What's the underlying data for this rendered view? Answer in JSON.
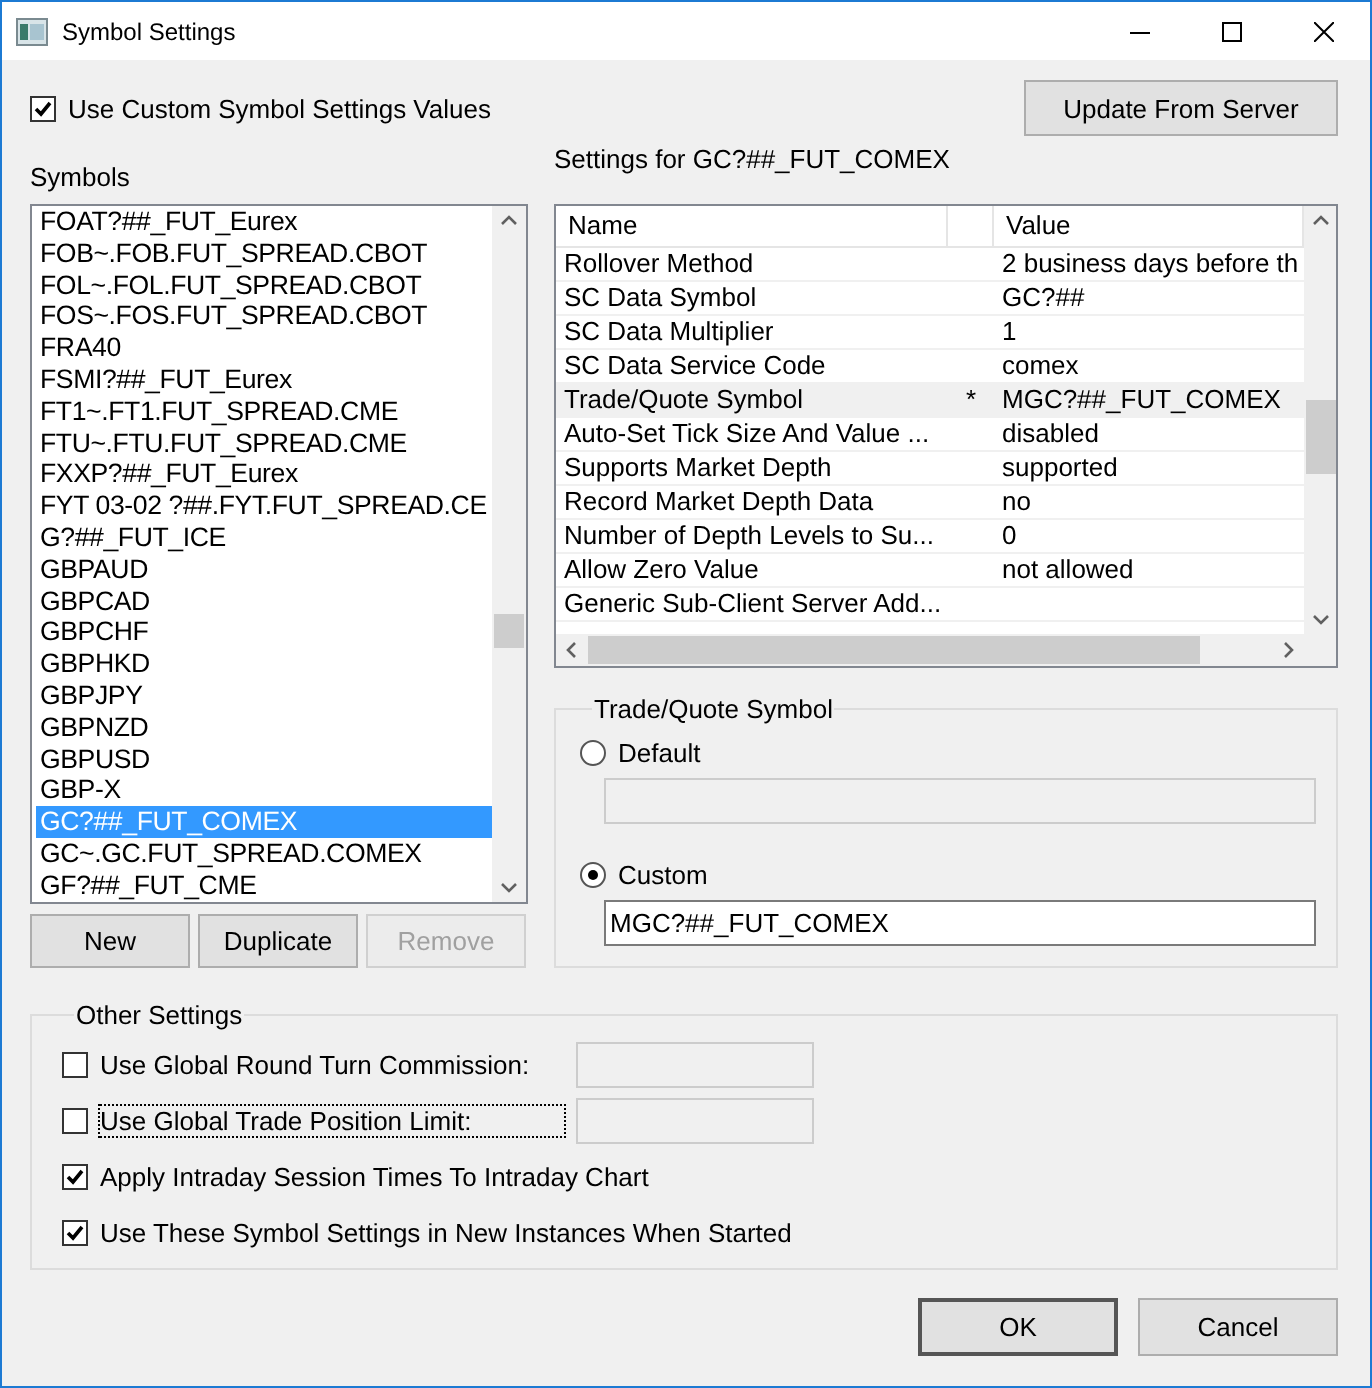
{
  "window": {
    "title": "Symbol Settings"
  },
  "use_custom": {
    "label": "Use Custom Symbol Settings Values",
    "checked": true
  },
  "update_button": {
    "label": "Update From Server"
  },
  "symbols": {
    "label": "Symbols",
    "items": [
      {
        "text": "FOAT?##_FUT_Eurex",
        "selected": false
      },
      {
        "text": "FOB~.FOB.FUT_SPREAD.CBOT",
        "selected": false
      },
      {
        "text": "FOL~.FOL.FUT_SPREAD.CBOT",
        "selected": false
      },
      {
        "text": "FOS~.FOS.FUT_SPREAD.CBOT",
        "selected": false
      },
      {
        "text": "FRA40",
        "selected": false
      },
      {
        "text": "FSMI?##_FUT_Eurex",
        "selected": false
      },
      {
        "text": "FT1~.FT1.FUT_SPREAD.CME",
        "selected": false
      },
      {
        "text": "FTU~.FTU.FUT_SPREAD.CME",
        "selected": false
      },
      {
        "text": "FXXP?##_FUT_Eurex",
        "selected": false
      },
      {
        "text": "FYT 03-02 ?##.FYT.FUT_SPREAD.CE",
        "selected": false
      },
      {
        "text": "G?##_FUT_ICE",
        "selected": false
      },
      {
        "text": "GBPAUD",
        "selected": false
      },
      {
        "text": "GBPCAD",
        "selected": false
      },
      {
        "text": "GBPCHF",
        "selected": false
      },
      {
        "text": "GBPHKD",
        "selected": false
      },
      {
        "text": "GBPJPY",
        "selected": false
      },
      {
        "text": "GBPNZD",
        "selected": false
      },
      {
        "text": "GBPUSD",
        "selected": false
      },
      {
        "text": "GBP-X",
        "selected": false
      },
      {
        "text": "GC?##_FUT_COMEX",
        "selected": true
      },
      {
        "text": "GC~.GC.FUT_SPREAD.COMEX",
        "selected": false
      },
      {
        "text": "GF?##_FUT_CME",
        "selected": false
      }
    ]
  },
  "symbol_buttons": [
    {
      "label": "New",
      "disabled": false
    },
    {
      "label": "Duplicate",
      "disabled": false
    },
    {
      "label": "Remove",
      "disabled": true
    }
  ],
  "settings": {
    "title": "Settings for GC?##_FUT_COMEX",
    "columns": [
      "Name",
      "Value"
    ],
    "rows": [
      {
        "name": "Rollover Method",
        "value": "2 business days before th",
        "selected": false
      },
      {
        "name": "SC Data Symbol",
        "value": "GC?##",
        "selected": false
      },
      {
        "name": "SC Data Multiplier",
        "value": "1",
        "selected": false
      },
      {
        "name": "SC Data Service Code",
        "value": "comex",
        "selected": false
      },
      {
        "name": "Trade/Quote Symbol",
        "marker": "*",
        "value": "MGC?##_FUT_COMEX",
        "selected": true
      },
      {
        "name": "Auto-Set Tick Size And Value ...",
        "value": "disabled",
        "selected": false
      },
      {
        "name": "Supports Market Depth",
        "value": "supported",
        "selected": false
      },
      {
        "name": "Record Market Depth Data",
        "value": "no",
        "selected": false
      },
      {
        "name": "Number of Depth Levels to Su...",
        "value": "0",
        "selected": false
      },
      {
        "name": "Allow Zero Value",
        "value": "not allowed",
        "selected": false
      },
      {
        "name": "Generic Sub-Client Server Add...",
        "selected": false
      }
    ]
  },
  "trade_quote": {
    "title": "Trade/Quote Symbol",
    "options": [
      {
        "label": "Default",
        "selected": false,
        "field": {
          "disabled": true
        }
      },
      {
        "label": "Custom",
        "selected": true,
        "field": {
          "value": "MGC?##_FUT_COMEX",
          "disabled": false
        }
      }
    ]
  },
  "other_settings": {
    "title": "Other Settings",
    "items": [
      {
        "kind": "checkbox-field",
        "label": "Use Global Round Turn Commission:",
        "checked": false,
        "focused": false,
        "field": {
          "disabled": true
        }
      },
      {
        "kind": "checkbox-field",
        "label": "Use Global Trade Position Limit:",
        "checked": false,
        "focused": true,
        "field": {
          "disabled": true
        }
      },
      {
        "kind": "checkbox",
        "label": "Apply Intraday Session Times To Intraday Chart",
        "checked": true,
        "focused": false
      },
      {
        "kind": "checkbox",
        "label": "Use These Symbol Settings in New Instances When Started",
        "checked": true,
        "focused": false
      }
    ]
  },
  "buttons": [
    {
      "label": "OK",
      "default": true
    },
    {
      "label": "Cancel",
      "default": false
    }
  ]
}
